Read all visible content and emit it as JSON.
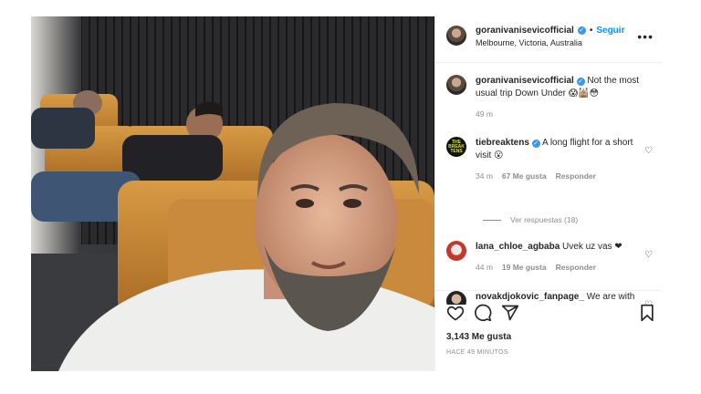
{
  "post": {
    "username": "goranivanisevicofficial",
    "follow_label": "Seguir",
    "location": "Melbourne, Victoria, Australia",
    "more_label": "•••",
    "caption": {
      "username": "goranivanisevicofficial",
      "text": "Not the most usual trip Down Under 😱🕍😳",
      "time": "49 m"
    },
    "likes": "3,143 Me gusta",
    "posted_ago": "HACE 49 MINUTOS",
    "photo_alt": "Selfie of a man on a lounge chair with two men sleeping behind him"
  },
  "comments": [
    {
      "username": "tiebreaktens",
      "text": "A long flight for a short visit 😮",
      "time": "34 m",
      "likes": "67 Me gusta",
      "reply_label": "Responder",
      "avatar_text": "THE BREAK TENS",
      "view_replies": "Ver respuestas (18)"
    },
    {
      "username": "lana_chloe_agbaba",
      "text": "Uvek uz vas ❤",
      "time": "44 m",
      "likes": "19 Me gusta",
      "reply_label": "Responder"
    },
    {
      "username": "novakdjokovic_fanpage_",
      "text": "We are with you ❤",
      "time": "",
      "likes": "",
      "reply_label": ""
    }
  ],
  "icons": {
    "verified": "verified-badge-icon",
    "heart": "heart-icon",
    "comment": "comment-icon",
    "share": "share-icon",
    "save": "bookmark-icon",
    "more": "more-options-icon"
  },
  "colors": {
    "accent": "#0095f6",
    "verified": "#3897f0",
    "muted": "#8e8e8e",
    "like_red": "#ed4956"
  }
}
